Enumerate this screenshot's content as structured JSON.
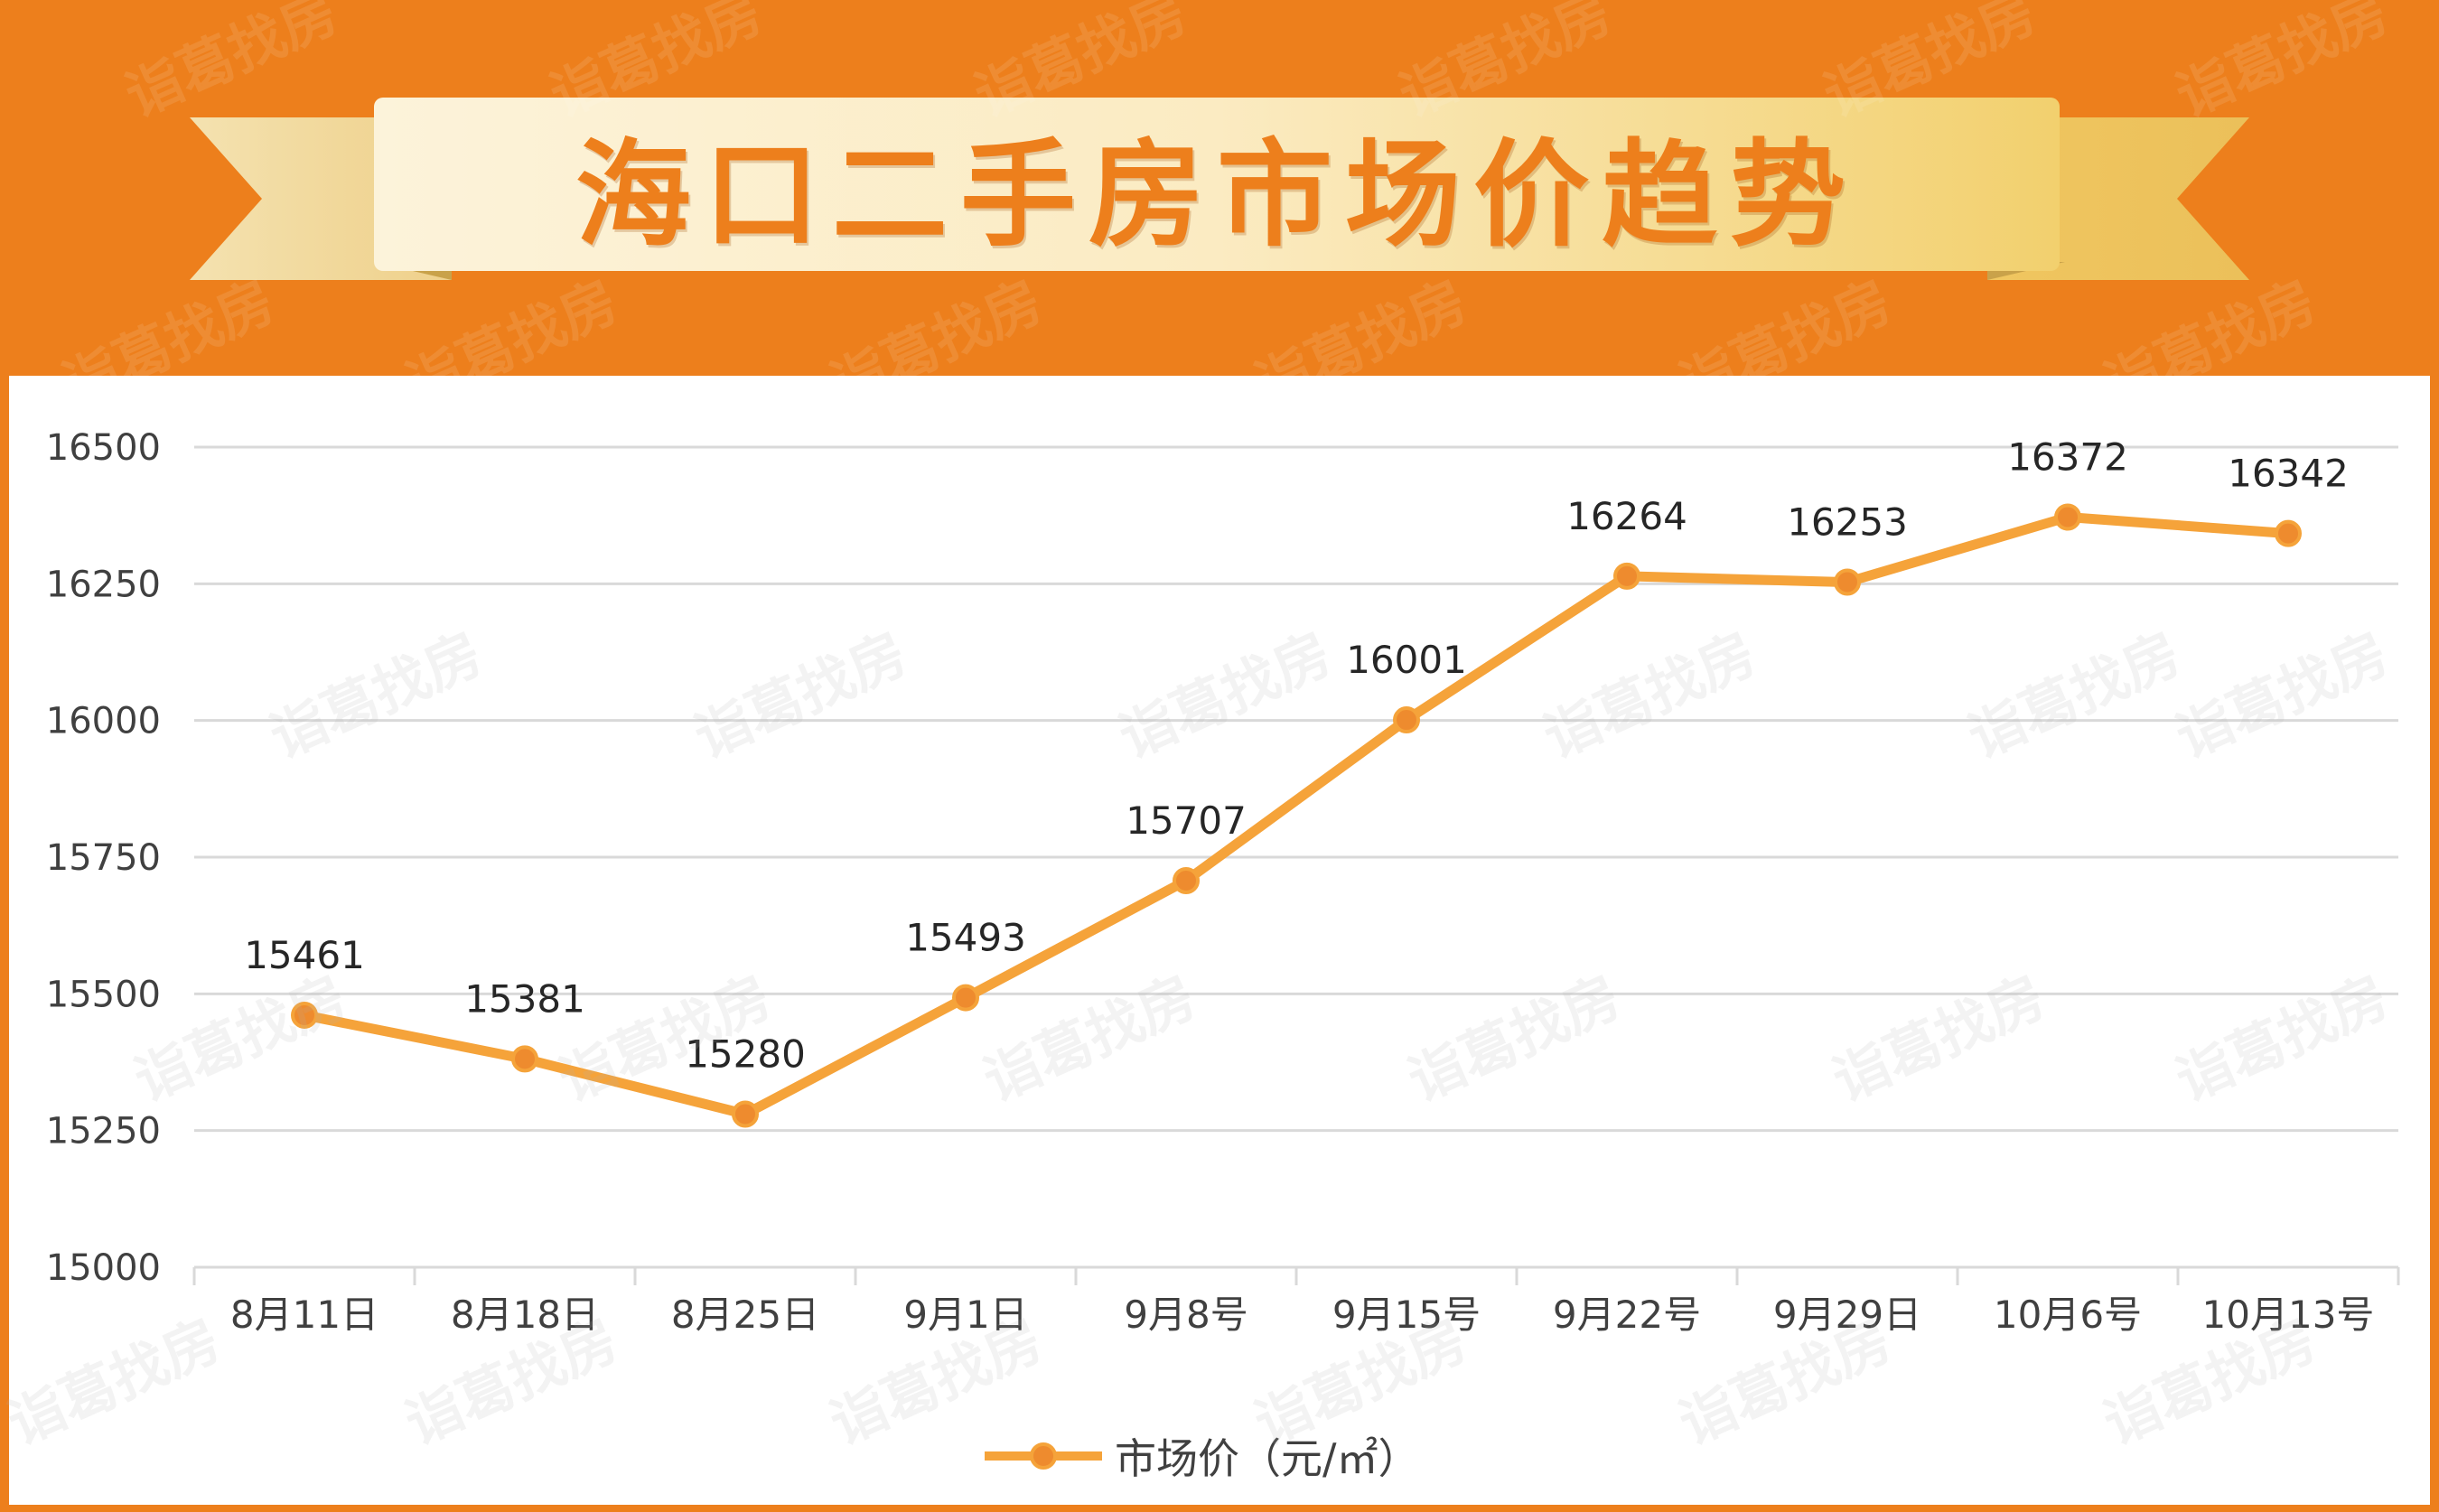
{
  "banner": {
    "title": "海口二手房市场价趋势",
    "colors": {
      "background": "#ED7F1C",
      "ribbon_light": "#FBF0D0",
      "ribbon_dark": "#F2D27A",
      "title": "#ED7F1C"
    }
  },
  "watermark": {
    "text": "诣葛找房"
  },
  "chart_data": {
    "type": "line",
    "categories": [
      "8月11日",
      "8月18日",
      "8月25日",
      "9月1日",
      "9月8号",
      "9月15号",
      "9月22号",
      "9月29日",
      "10月6号",
      "10月13号"
    ],
    "series": [
      {
        "name": "市场价（元/㎡）",
        "values": [
          15461,
          15381,
          15280,
          15493,
          15707,
          16001,
          16264,
          16253,
          16372,
          16342
        ],
        "color": "#F5A33A",
        "marker_color": "#EE8B2E"
      }
    ],
    "yticks": [
      16500,
      16250,
      16000,
      15750,
      15500,
      15250,
      15000
    ],
    "ylim": [
      15000,
      16500
    ],
    "grid": true,
    "legend": "bottom",
    "data_labels": true
  }
}
